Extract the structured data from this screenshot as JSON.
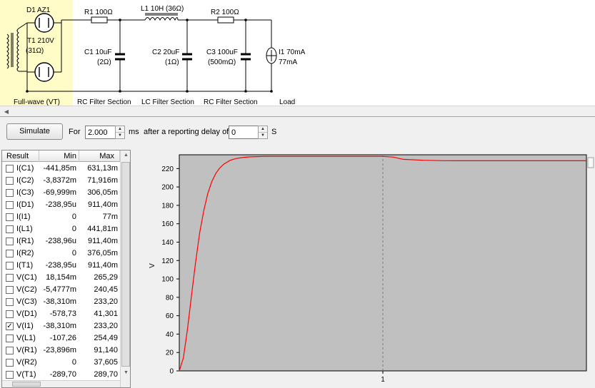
{
  "schematic": {
    "rectifier": {
      "tube": "D1 AZ1",
      "transformer": "T1 210V",
      "transformer_r": "(31Ω)",
      "section": "Full-wave (VT)"
    },
    "r1": "R1 100Ω",
    "l1": "L1 10H (36Ω)",
    "r2": "R2 100Ω",
    "c1": {
      "value": "C1 10uF",
      "esr": "(2Ω)"
    },
    "c2": {
      "value": "C2 20uF",
      "esr": "(1Ω)"
    },
    "c3": {
      "value": "C3 100uF",
      "esr": "(500mΩ)"
    },
    "i1": {
      "value": "I1 70mA",
      "current": "77mA"
    },
    "sections": [
      "RC Filter Section",
      "LC Filter Section",
      "RC Filter Section",
      "Load"
    ]
  },
  "toolbar": {
    "simulate_label": "Simulate",
    "for_label": "For",
    "duration_value": "2.000",
    "duration_unit": "ms",
    "delay_label": "after a reporting delay of",
    "delay_value": "0",
    "delay_unit": "S"
  },
  "results": {
    "headers": {
      "result": "Result",
      "min": "Min",
      "max": "Max"
    },
    "rows": [
      {
        "name": "I(C1)",
        "min": "-441,85m",
        "max": "631,13m",
        "checked": false
      },
      {
        "name": "I(C2)",
        "min": "-3,8372m",
        "max": "71,916m",
        "checked": false
      },
      {
        "name": "I(C3)",
        "min": "-69,999m",
        "max": "306,05m",
        "checked": false
      },
      {
        "name": "I(D1)",
        "min": "-238,95u",
        "max": "911,40m",
        "checked": false
      },
      {
        "name": "I(I1)",
        "min": "0",
        "max": "77m",
        "checked": false
      },
      {
        "name": "I(L1)",
        "min": "0",
        "max": "441,81m",
        "checked": false
      },
      {
        "name": "I(R1)",
        "min": "-238,96u",
        "max": "911,40m",
        "checked": false
      },
      {
        "name": "I(R2)",
        "min": "0",
        "max": "376,05m",
        "checked": false
      },
      {
        "name": "I(T1)",
        "min": "-238,95u",
        "max": "911,40m",
        "checked": false
      },
      {
        "name": "V(C1)",
        "min": "18,154m",
        "max": "265,29",
        "checked": false
      },
      {
        "name": "V(C2)",
        "min": "-5,4777m",
        "max": "240,45",
        "checked": false
      },
      {
        "name": "V(C3)",
        "min": "-38,310m",
        "max": "233,20",
        "checked": false
      },
      {
        "name": "V(D1)",
        "min": "-578,73",
        "max": "41,301",
        "checked": false
      },
      {
        "name": "V(I1)",
        "min": "-38,310m",
        "max": "233,20",
        "checked": true
      },
      {
        "name": "V(L1)",
        "min": "-107,26",
        "max": "254,49",
        "checked": false
      },
      {
        "name": "V(R1)",
        "min": "-23,896m",
        "max": "91,140",
        "checked": false
      },
      {
        "name": "V(R2)",
        "min": "0",
        "max": "37,605",
        "checked": false
      },
      {
        "name": "V(T1)",
        "min": "-289,70",
        "max": "289,70",
        "checked": false
      }
    ]
  },
  "chart_data": {
    "type": "line",
    "ylabel": "V",
    "xlabel": "",
    "ylim": [
      0,
      235
    ],
    "xlim": [
      0,
      2
    ],
    "yticks": [
      0,
      20,
      40,
      60,
      80,
      100,
      120,
      140,
      160,
      180,
      200,
      220
    ],
    "xticks": [
      1
    ],
    "grid": true,
    "series": [
      {
        "color": "#ff0000",
        "x": [
          0.0,
          0.02,
          0.04,
          0.06,
          0.08,
          0.1,
          0.12,
          0.14,
          0.16,
          0.18,
          0.2,
          0.22,
          0.25,
          0.28,
          0.31,
          0.34,
          0.38,
          0.42,
          0.46,
          0.5,
          0.55,
          0.6,
          0.65,
          0.7,
          0.75,
          0.8,
          0.85,
          0.9,
          0.95,
          1.0,
          1.05,
          1.1,
          1.2,
          1.3,
          1.4,
          1.5,
          1.6,
          1.7,
          1.8,
          1.9,
          2.0
        ],
        "y": [
          0,
          14,
          45,
          82,
          118,
          150,
          174,
          193,
          206,
          215,
          221,
          225,
          229,
          231,
          232,
          232.7,
          233,
          233.2,
          233.2,
          233.2,
          233.2,
          233.2,
          233.2,
          233.2,
          233.2,
          233.2,
          233.2,
          233.2,
          233.2,
          233.2,
          232.5,
          230,
          229,
          228.6,
          228.5,
          228.5,
          228.5,
          228.5,
          228.5,
          228.5,
          228.5
        ]
      }
    ]
  }
}
